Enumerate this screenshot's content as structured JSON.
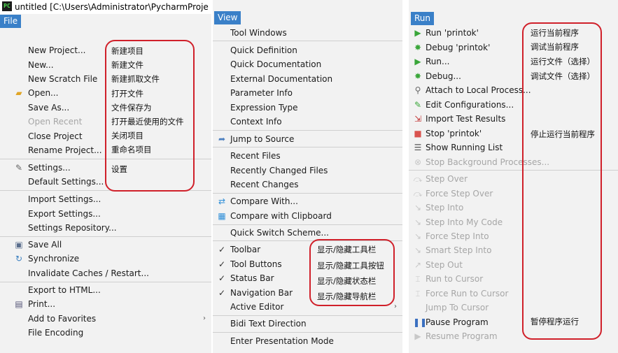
{
  "file_panel": {
    "window_title": "untitled [C:\\Users\\Administrator\\PycharmProje",
    "app_logo": "PC",
    "menu_label": "File",
    "items": [
      {
        "label": "New Project...",
        "note": "新建项目"
      },
      {
        "label": "New...",
        "note": "新建文件"
      },
      {
        "label": "New Scratch File",
        "note": "新建抓取文件"
      },
      {
        "label": "Open...",
        "note": "打开文件"
      },
      {
        "label": "Save As...",
        "note": "文件保存为"
      },
      {
        "label": "Open Recent",
        "note": "打开最近使用的文件"
      },
      {
        "label": "Close Project",
        "note": "关闭项目"
      },
      {
        "label": "Rename Project...",
        "note": "重命名项目"
      },
      {
        "label": "Settings...",
        "note": "设置"
      },
      {
        "label": "Default Settings..."
      },
      {
        "label": "Import Settings..."
      },
      {
        "label": "Export Settings..."
      },
      {
        "label": "Settings Repository..."
      },
      {
        "label": "Save All"
      },
      {
        "label": "Synchronize"
      },
      {
        "label": "Invalidate Caches / Restart..."
      },
      {
        "label": "Export to HTML..."
      },
      {
        "label": "Print..."
      },
      {
        "label": "Add to Favorites"
      },
      {
        "label": "File Encoding"
      }
    ]
  },
  "view_panel": {
    "menu_label": "View",
    "items": [
      {
        "label": "Tool Windows"
      },
      {
        "label": "Quick Definition"
      },
      {
        "label": "Quick Documentation"
      },
      {
        "label": "External Documentation"
      },
      {
        "label": "Parameter Info"
      },
      {
        "label": "Expression Type"
      },
      {
        "label": "Context Info"
      },
      {
        "label": "Jump to Source"
      },
      {
        "label": "Recent Files"
      },
      {
        "label": "Recently Changed Files"
      },
      {
        "label": "Recent Changes"
      },
      {
        "label": "Compare With..."
      },
      {
        "label": "Compare with Clipboard"
      },
      {
        "label": "Quick Switch Scheme..."
      },
      {
        "label": "Toolbar",
        "note": "显示/隐藏工具栏"
      },
      {
        "label": "Tool Buttons",
        "note": "显示/隐藏工具按钮"
      },
      {
        "label": "Status Bar",
        "note": "显示/隐藏状态栏"
      },
      {
        "label": "Navigation Bar",
        "note": "显示/隐藏导航栏"
      },
      {
        "label": "Active Editor"
      },
      {
        "label": "Bidi Text Direction"
      },
      {
        "label": "Enter Presentation Mode"
      }
    ]
  },
  "run_panel": {
    "menu_label": "Run",
    "items": [
      {
        "label": "Run 'printok'",
        "note": "运行当前程序"
      },
      {
        "label": "Debug 'printok'",
        "note": "调试当前程序"
      },
      {
        "label": "Run...",
        "note": "运行文件（选择）"
      },
      {
        "label": "Debug...",
        "note": "调试文件（选择）"
      },
      {
        "label": "Attach to Local Process..."
      },
      {
        "label": "Edit Configurations..."
      },
      {
        "label": "Import Test Results"
      },
      {
        "label": "Stop 'printok'",
        "note": "停止运行当前程序"
      },
      {
        "label": "Show Running List"
      },
      {
        "label": "Stop Background Processes..."
      },
      {
        "label": "Step Over"
      },
      {
        "label": "Force Step Over"
      },
      {
        "label": "Step Into"
      },
      {
        "label": "Step Into My Code"
      },
      {
        "label": "Force Step Into"
      },
      {
        "label": "Smart Step Into"
      },
      {
        "label": "Step Out"
      },
      {
        "label": "Run to Cursor"
      },
      {
        "label": "Force Run to Cursor"
      },
      {
        "label": "Jump To Cursor"
      },
      {
        "label": "Pause Program",
        "note": "暂停程序运行"
      },
      {
        "label": "Resume Program"
      }
    ]
  },
  "colors": {
    "menu_header": "#3a80c8",
    "annotation": "#d0202a",
    "disabled_text": "#a6a6a6",
    "panel_bg": "#f2f2f2"
  }
}
